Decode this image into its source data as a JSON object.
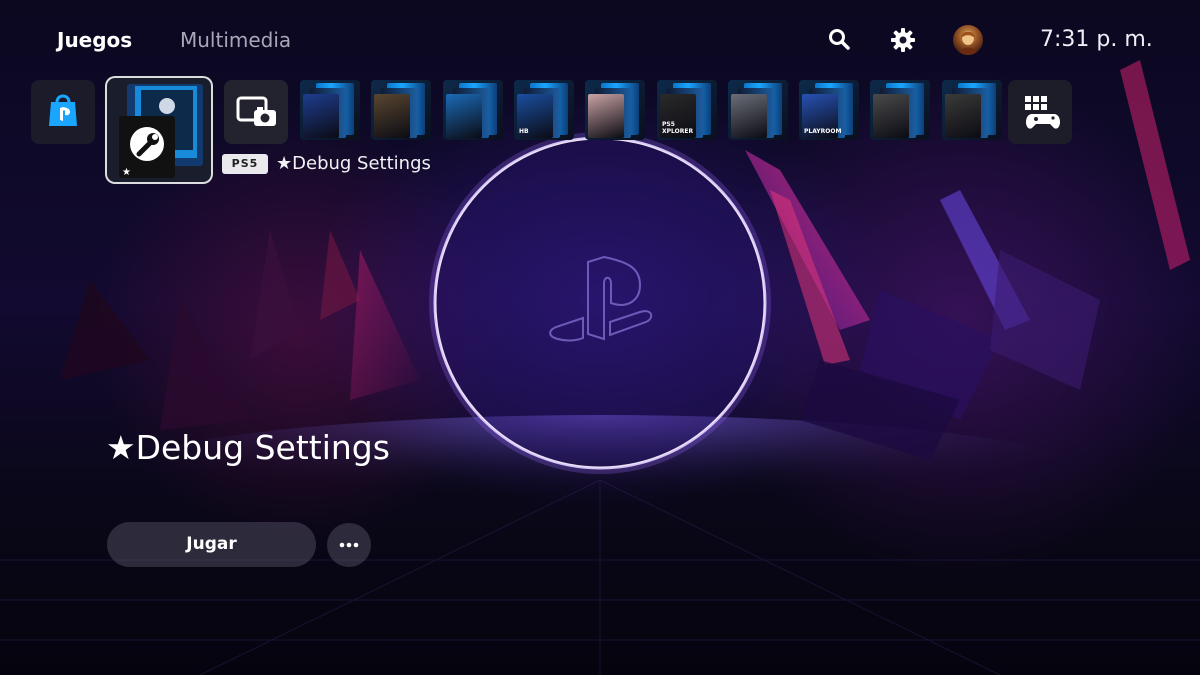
{
  "top_bar": {
    "tabs": [
      {
        "label": "Juegos",
        "active": true
      },
      {
        "label": "Multimedia",
        "active": false
      }
    ],
    "icons": [
      "search-icon",
      "settings-gear-icon",
      "user-avatar"
    ],
    "clock": "7:31 p. m."
  },
  "tiles_row": {
    "store_icon": "playstation-store-icon",
    "selected": {
      "icon": "wrench-icon",
      "platform_badge": "PS5",
      "caption": "★Debug Settings"
    },
    "capture_icon": "media-gallery-camera-icon",
    "game_tiles": [
      {
        "caption": "",
        "color": "#1e3d8f"
      },
      {
        "caption": "",
        "color": "#5a4630"
      },
      {
        "caption": "",
        "color": "#1b6bb8"
      },
      {
        "caption": "HB",
        "color": "#1a4fa0"
      },
      {
        "caption": "",
        "color": "#c9a3a3"
      },
      {
        "caption": "PS5 XPLORER",
        "color": "#2a2a2a"
      },
      {
        "caption": "",
        "color": "#6b6e78"
      },
      {
        "caption": "PLAYROOM",
        "color": "#2752b5"
      },
      {
        "caption": "",
        "color": "#4a4a4a"
      },
      {
        "caption": "",
        "color": "#3a3a38"
      }
    ],
    "library_icon": "game-library-icon"
  },
  "main": {
    "title": "★Debug Settings",
    "play_label": "Jugar",
    "more_icon": "more-options-icon"
  },
  "colors": {
    "accent_blue": "#1aa6ff",
    "ring_glow": "#f0e6ff",
    "background_magenta": "#c0186a",
    "background_violet": "#5a2ad0"
  }
}
